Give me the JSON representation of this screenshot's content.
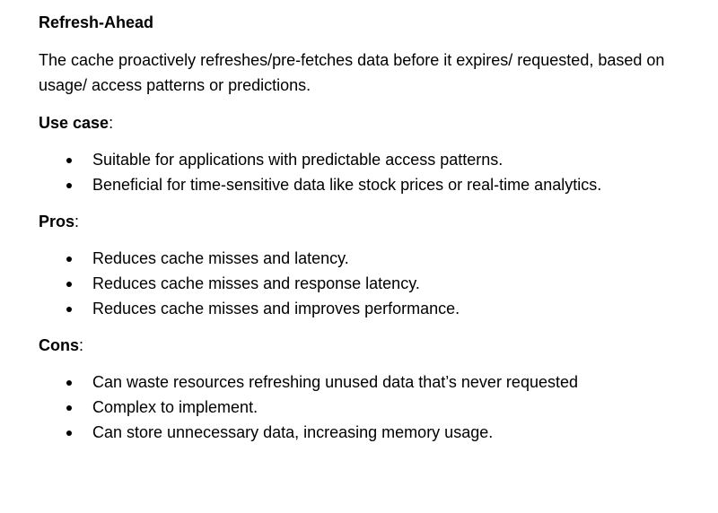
{
  "section": {
    "title": "Refresh-Ahead",
    "description": "The cache proactively refreshes/pre-fetches data before it expires/ requested, based on usage/ access patterns or predictions."
  },
  "use_case": {
    "label": "Use case",
    "colon": ":",
    "items": [
      "Suitable for applications with predictable access patterns.",
      "Beneficial for time-sensitive data like stock prices or real-time analytics."
    ]
  },
  "pros": {
    "label": "Pros",
    "colon": ":",
    "items": [
      "Reduces cache misses and latency.",
      "Reduces cache misses and response latency.",
      "Reduces cache misses and improves performance."
    ]
  },
  "cons": {
    "label": "Cons",
    "colon": ":",
    "items": [
      "Can waste resources refreshing unused data that’s never requested",
      "Complex to implement.",
      "Can store unnecessary data, increasing memory usage."
    ]
  }
}
